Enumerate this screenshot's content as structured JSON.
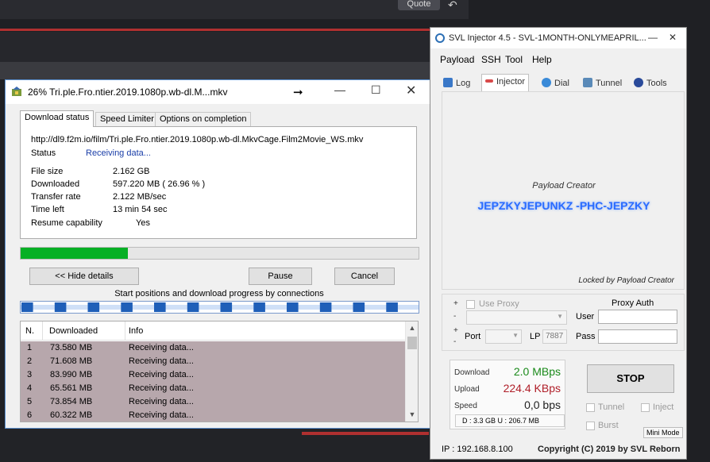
{
  "background": {
    "quote_button": "Quote"
  },
  "idm": {
    "title": "26% Tri.ple.Fro.ntier.2019.1080p.wb-dl.M...mkv",
    "tabs": [
      "Download status",
      "Speed Limiter",
      "Options on completion"
    ],
    "url": "http://dl9.f2m.io/film/Tri.ple.Fro.ntier.2019.1080p.wb-dl.MkvCage.Film2Movie_WS.mkv",
    "status_label": "Status",
    "status_value": "Receiving data...",
    "file_size_label": "File size",
    "file_size_value": "2.162  GB",
    "downloaded_label": "Downloaded",
    "downloaded_value": "597.220  MB  ( 26.96 % )",
    "transfer_rate_label": "Transfer rate",
    "transfer_rate_value": "2.122  MB/sec",
    "time_left_label": "Time left",
    "time_left_value": "13 min 54 sec",
    "resume_label": "Resume capability",
    "resume_value": "Yes",
    "progress_fraction": 0.2696,
    "hide_details_button": "<< Hide details",
    "pause_button": "Pause",
    "cancel_button": "Cancel",
    "segments_label": "Start positions and download progress by connections",
    "list_headers": [
      "N.",
      "Downloaded",
      "Info"
    ],
    "connections": [
      {
        "n": "1",
        "downloaded": "73.580  MB",
        "info": "Receiving data..."
      },
      {
        "n": "2",
        "downloaded": "71.608  MB",
        "info": "Receiving data..."
      },
      {
        "n": "3",
        "downloaded": "83.990  MB",
        "info": "Receiving data..."
      },
      {
        "n": "4",
        "downloaded": "65.561  MB",
        "info": "Receiving data..."
      },
      {
        "n": "5",
        "downloaded": "73.854  MB",
        "info": "Receiving data..."
      },
      {
        "n": "6",
        "downloaded": "60.322  MB",
        "info": "Receiving data..."
      }
    ]
  },
  "svl": {
    "title": "SVL Injector 4.5 - SVL-1MONTH-ONLYMEAPRIL...",
    "menu": [
      "Payload",
      "SSH",
      "Tool",
      "Help"
    ],
    "tabs": [
      "Log",
      "Injector",
      "Dial",
      "Tunnel",
      "Tools"
    ],
    "payload_creator_label": "Payload Creator",
    "creator_name": "JEPZKYJEPUNKZ -PHC-JEPZKY",
    "locked_text": "Locked by Payload Creator",
    "use_proxy_label": "Use Proxy",
    "proxy_auth_label": "Proxy Auth",
    "user_label": "User",
    "pass_label": "Pass",
    "port_label": "Port",
    "lp_label": "LP",
    "lp_value": "7887",
    "download_label": "Download",
    "download_value": "2.0 MBps",
    "upload_label": "Upload",
    "upload_value": "224.4 KBps",
    "speed_label": "Speed",
    "speed_value": "0,0 bps",
    "totals": "D :     3.3 GB    U :  206.7 MB",
    "stop_button": "STOP",
    "tunnel_label": "Tunnel",
    "inject_label": "Inject",
    "burst_label": "Burst",
    "mini_mode_button": "Mini Mode",
    "ip_text": "IP : 192.168.8.100",
    "copyright": "Copyright (C) 2019 by SVL Reborn",
    "colors": {
      "download": "#1a8a1a",
      "upload": "#b0202a",
      "progress": "#06b025"
    }
  }
}
